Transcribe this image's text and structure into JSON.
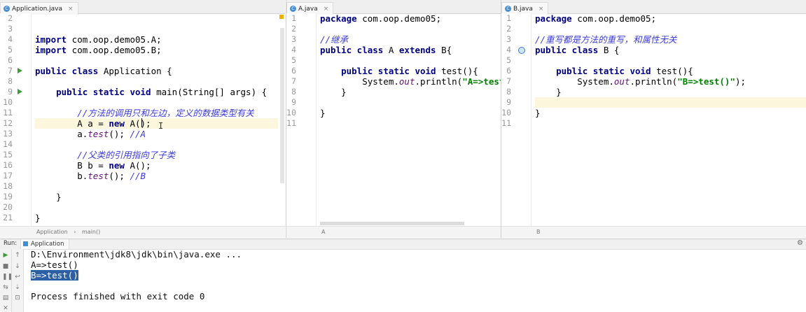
{
  "panes": {
    "application": {
      "tab": "Application.java",
      "breadcrumb": [
        "Application",
        "main()"
      ],
      "line_numbers": [
        "2",
        "3",
        "4",
        "5",
        "6",
        "7",
        "8",
        "9",
        "10",
        "11",
        "12",
        "13",
        "14",
        "15",
        "16",
        "17",
        "18",
        "19",
        "20",
        "21"
      ],
      "lines": [
        "",
        "",
        "import com.oop.demo05.A;",
        "import com.oop.demo05.B;",
        "",
        "public class Application {",
        "",
        "    public static void main(String[] args) {",
        "",
        "        //方法的调用只和左边，定义的数据类型有关",
        "        A a = new A();",
        "        a.test(); //A",
        "",
        "        //父类的引用指向了子类",
        "        B b = new A();",
        "        b.test(); //B",
        "",
        "    }",
        "",
        "}"
      ]
    },
    "a_java": {
      "tab": "A.java",
      "breadcrumb": "A",
      "line_numbers": [
        "1",
        "2",
        "3",
        "4",
        "5",
        "6",
        "7",
        "8",
        "9",
        "10",
        "11"
      ],
      "lines": [
        "package com.oop.demo05;",
        "",
        "//继承",
        "public class A extends B{",
        "",
        "    public static void test(){",
        "        System.out.println(\"A=>test()\");",
        "    }",
        "",
        "}",
        ""
      ]
    },
    "b_java": {
      "tab": "B.java",
      "breadcrumb": "B",
      "line_numbers": [
        "1",
        "2",
        "3",
        "4",
        "5",
        "6",
        "7",
        "8",
        "9",
        "10",
        "11"
      ],
      "lines": [
        "package com.oop.demo05;",
        "",
        "//重写都是方法的重写，和属性无关",
        "public class B {",
        "",
        "    public static void test(){",
        "        System.out.println(\"B=>test()\");",
        "    }",
        "",
        "}",
        ""
      ]
    }
  },
  "run": {
    "label": "Run:",
    "tab": "Application",
    "console": [
      "D:\\Environment\\jdk8\\jdk\\bin\\java.exe ...",
      "A=>test()",
      "B=>test()",
      "",
      "Process finished with exit code 0"
    ]
  },
  "colors": {
    "keyword": "#000080",
    "comment": "#3a3adb",
    "string": "#008000",
    "highlight": "#fcf6dd",
    "selection": "#2d5fa5"
  }
}
